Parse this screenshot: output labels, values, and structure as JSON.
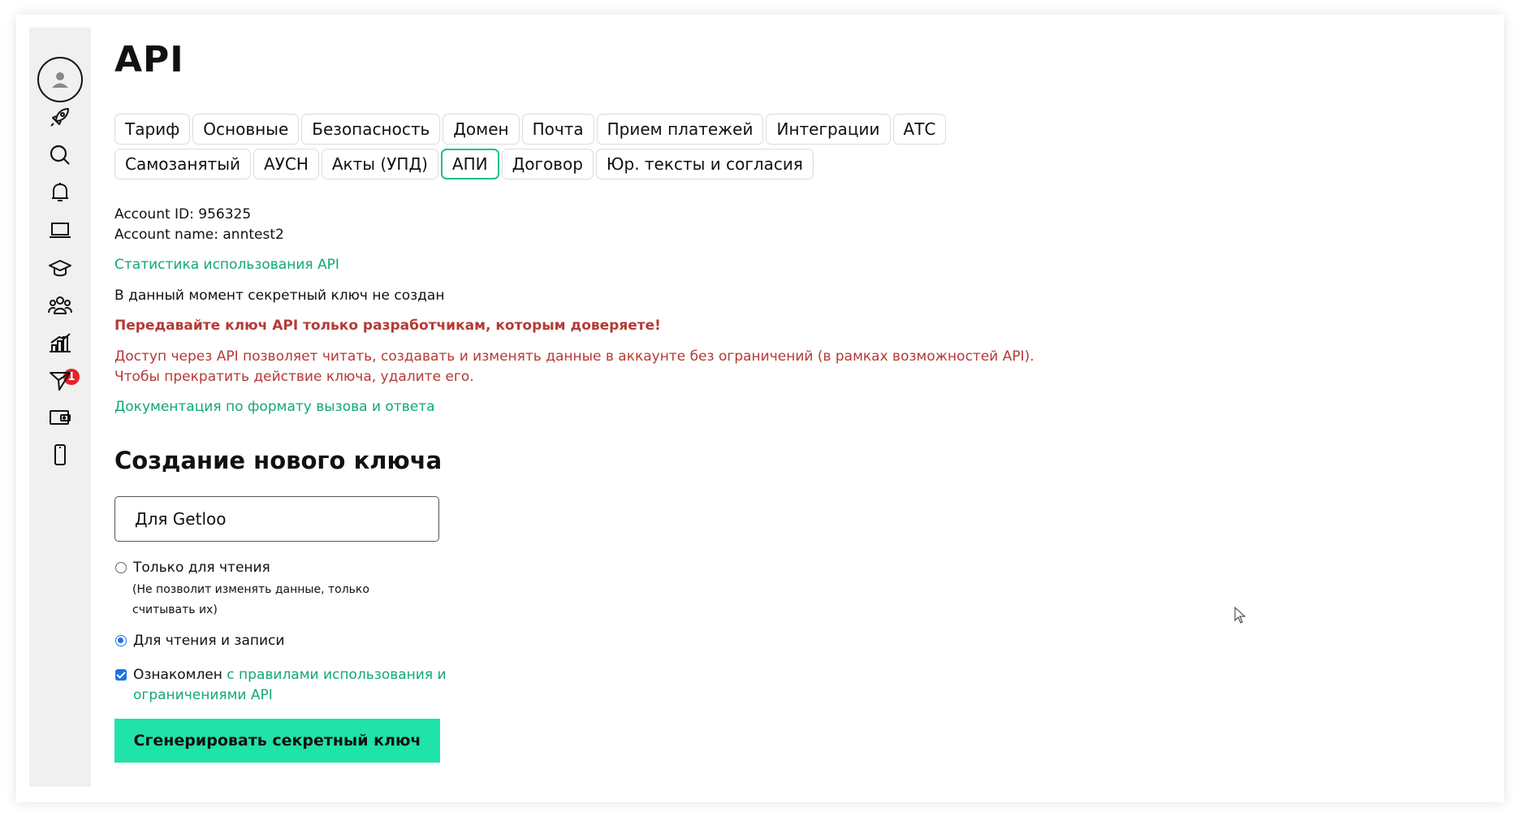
{
  "page": {
    "title": "API"
  },
  "sidebar": {
    "icons": [
      "user-icon",
      "rocket-icon",
      "search-icon",
      "bell-icon",
      "laptop-icon",
      "graduation-cap-icon",
      "users-icon",
      "chart-icon",
      "send-icon",
      "wallet-icon",
      "phone-icon"
    ],
    "badge": "1"
  },
  "tabs": {
    "row1": [
      "Тариф",
      "Основные",
      "Безопасность",
      "Домен",
      "Почта",
      "Прием платежей",
      "Интеграции",
      "АТС"
    ],
    "row2": [
      "Самозанятый",
      "АУСН",
      "Акты (УПД)",
      "АПИ",
      "Договор",
      "Юр. тексты и согласия"
    ],
    "active": "АПИ"
  },
  "account": {
    "id_line": "Account ID: 956325",
    "name_line": "Account name: anntest2"
  },
  "links": {
    "stats": "Статистика использования API",
    "docs": "Документация по формату вызова и ответа"
  },
  "messages": {
    "no_key": "В данный момент секретный ключ не создан",
    "warning": "Передавайте ключ API только разработчикам, которым доверяете!",
    "access_line1": "Доступ через API позволяет читать, создавать и изменять данные в аккаунте без ограничений (в рамках возможностей API).",
    "access_line2": "Чтобы прекратить действие ключа, удалите его."
  },
  "form": {
    "section_title": "Создание нового ключа",
    "key_name_value": "Для Getloo",
    "readonly_label": "Только для чтения",
    "readonly_hint": "(Не позволит изменять данные, только считывать их)",
    "readwrite_label": "Для чтения и записи",
    "selected": "readwrite",
    "agree_prefix": "Ознакомлен ",
    "agree_link": "с правилами использования и ограничениями API",
    "agree_checked": true,
    "submit_label": "Сгенерировать секретный ключ"
  },
  "colors": {
    "accent": "#20e3a9",
    "link": "#13a777",
    "warning": "#b53a34",
    "active_tab_border": "#1fbf86",
    "badge": "#e4222f"
  }
}
